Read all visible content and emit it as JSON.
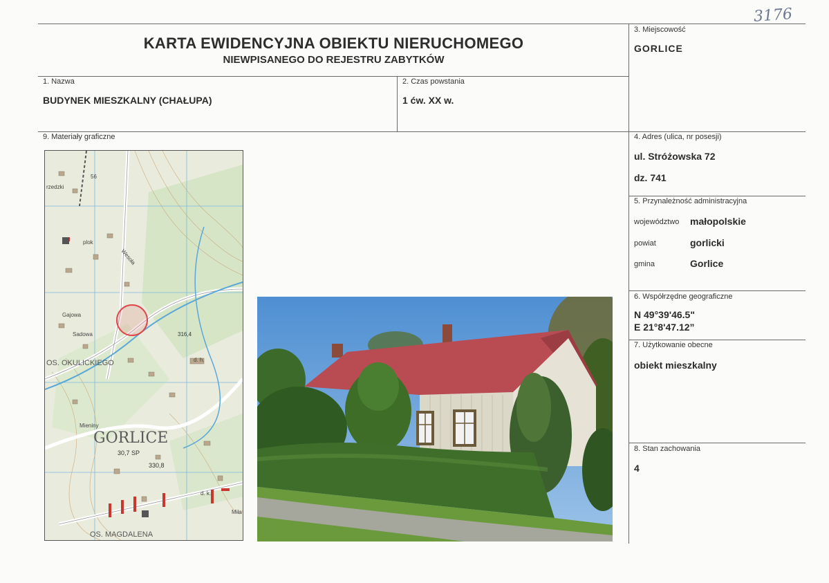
{
  "header": {
    "handwritten_number": "3176",
    "title": "KARTA EWIDENCYJNA OBIEKTU NIERUCHOMEGO",
    "subtitle": "NIEWPISANEGO DO REJESTRU ZABYTKÓW"
  },
  "fields": {
    "locality": {
      "label": "3. Miejscowość",
      "value": "GORLICE"
    },
    "name": {
      "label": "1. Nazwa",
      "value": "BUDYNEK MIESZKALNY (CHAŁUPA)"
    },
    "date": {
      "label": "2. Czas powstania",
      "value": "1 ćw. XX w."
    },
    "graphics": {
      "label": "9. Materiały graficzne"
    },
    "address": {
      "label": "4. Adres (ulica, nr posesji)",
      "street": "ul. Stróżowska 72",
      "plot": "dz. 741"
    },
    "admin": {
      "label": "5. Przynależność administracyjna",
      "rows": [
        {
          "key": "województwo",
          "value": "małopolskie"
        },
        {
          "key": "powiat",
          "value": "gorlicki"
        },
        {
          "key": "gmina",
          "value": "Gorlice"
        }
      ]
    },
    "coords": {
      "label": "6. Współrzędne geograficzne",
      "lat": "N 49°39'46.5\"",
      "lon": "E 21°8'47.12”"
    },
    "usage": {
      "label": "7. Użytkowanie obecne",
      "value": "obiekt mieszkalny"
    },
    "condition": {
      "label": "8. Stan zachowania",
      "value": "4"
    }
  },
  "map_labels": {
    "town": "GORLICE",
    "spot_height": "30,7 SP",
    "elevation1": "330,8",
    "elevation2": "316,4",
    "district1": "OS. OKULICKIEGO",
    "district2": "OS. MAGDALENA",
    "street1": "Gajowa",
    "street2": "Sadowa",
    "street3": "Wesoła",
    "street4": "Mieniny",
    "street5": "Miła",
    "label56": "56",
    "label_dh": "d. h.",
    "label_dk": "d. k.",
    "label_rzedzki": "rzedzki",
    "label_plok": "plok"
  },
  "colors": {
    "border": "#6b6b6b",
    "map_bg": "#e9ebdc",
    "map_road": "#f0f0ea",
    "map_river": "#5aa7d8",
    "map_marker": "#e0454a",
    "sky": "#5b98d6",
    "roof": "#b94c52",
    "wall": "#dcd8c8",
    "hedge": "#3f6e2b",
    "grass": "#6a9a3c"
  }
}
